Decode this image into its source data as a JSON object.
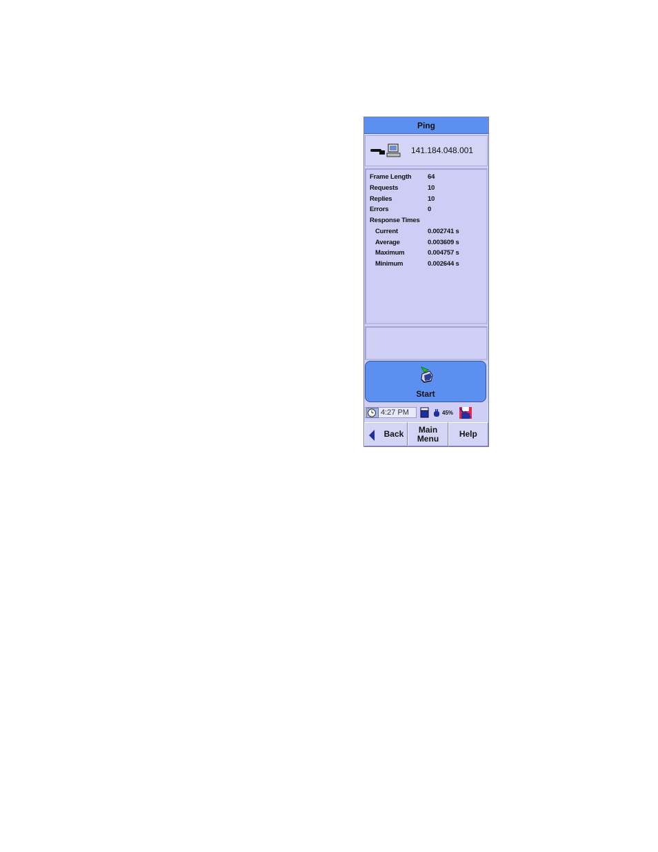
{
  "window": {
    "title": "Ping"
  },
  "target": {
    "ip_address": "141.184.048.001"
  },
  "results": {
    "frame_length": {
      "label": "Frame Length",
      "value": "64"
    },
    "requests": {
      "label": "Requests",
      "value": "10"
    },
    "replies": {
      "label": "Replies",
      "value": "10"
    },
    "errors": {
      "label": "Errors",
      "value": "0"
    },
    "response_times": {
      "label": "Response Times",
      "current": {
        "label": "Current",
        "value": "0.002741 s"
      },
      "average": {
        "label": "Average",
        "value": "0.003609 s"
      },
      "maximum": {
        "label": "Maximum",
        "value": "0.004757 s"
      },
      "minimum": {
        "label": "Minimum",
        "value": "0.002644 s"
      }
    }
  },
  "actions": {
    "start_label": "Start"
  },
  "status": {
    "time": "4:27 PM",
    "battery": "45%"
  },
  "softkeys": {
    "back": "Back",
    "main_menu_line1": "Main",
    "main_menu_line2": "Menu",
    "help": "Help"
  },
  "icons": {
    "connection": "network-connection-icon",
    "computer": "computer-icon",
    "start": "start-hand-arrow-icon",
    "clock": "clock-icon",
    "battery": "battery-icon",
    "save": "save-icon",
    "back": "back-arrow-icon"
  },
  "colors": {
    "title_bar": "#5b8ff0",
    "panel": "#cfcff5",
    "start_button": "#5b8ff0"
  }
}
